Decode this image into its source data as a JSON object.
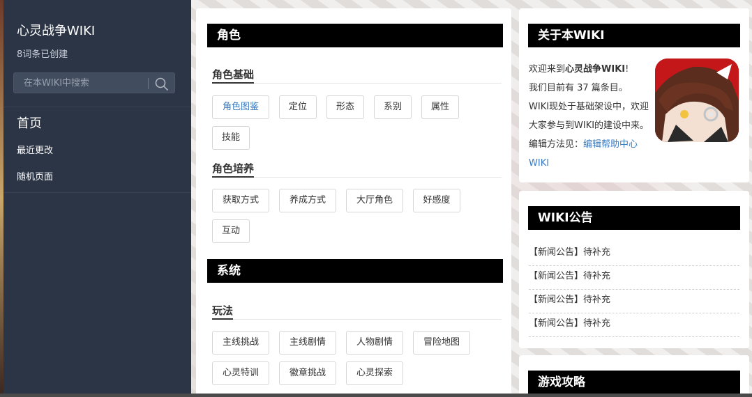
{
  "sidebar": {
    "title": "心灵战争WIKI",
    "subtitle": "8词条已创建",
    "search_placeholder": "在本WIKI中搜索",
    "home": "首页",
    "nav": [
      "最近更改",
      "随机页面"
    ]
  },
  "main": {
    "sections": [
      {
        "title": "角色",
        "groups": [
          {
            "title": "角色基础",
            "tags": [
              "角色图鉴",
              "定位",
              "形态",
              "系别",
              "属性",
              "技能"
            ],
            "active": "角色图鉴"
          },
          {
            "title": "角色培养",
            "tags": [
              "获取方式",
              "养成方式",
              "大厅角色",
              "好感度",
              "互动"
            ]
          }
        ]
      },
      {
        "title": "系统",
        "groups": [
          {
            "title": "玩法",
            "tags": [
              "主线挑战",
              "主线剧情",
              "人物剧情",
              "冒险地图",
              "心灵特训",
              "徽章挑战",
              "心灵探索"
            ]
          }
        ]
      }
    ]
  },
  "about": {
    "title": "关于本WIKI",
    "welcome_pre": "欢迎来到",
    "welcome_name": "心灵战争WIKI",
    "welcome_post": "!",
    "count_text": "我们目前有 37 篇条目。",
    "status_text": "WIKI现处于基础架设中，欢迎大家参与到WIKI的建设中来。",
    "edit_label": "编辑方法见：",
    "edit_link": "编辑帮助中心WIKI"
  },
  "notice": {
    "title": "WIKI公告",
    "items": [
      "【新闻公告】待补充",
      "【新闻公告】待补充",
      "【新闻公告】待补充",
      "【新闻公告】待补充"
    ]
  },
  "guide": {
    "title": "游戏攻略"
  },
  "colors": {
    "sidebar_bg": "#2b3546",
    "link": "#3b7bbf",
    "bar_bg": "#000000"
  }
}
